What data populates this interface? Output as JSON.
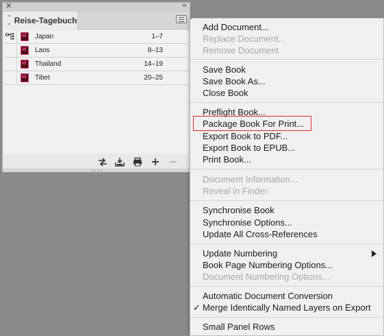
{
  "panel": {
    "tab_title": "Reise-Tagebuch",
    "documents": [
      {
        "name": "Japan",
        "pages": "1–7"
      },
      {
        "name": "Laos",
        "pages": "8–13"
      },
      {
        "name": "Thailand",
        "pages": "14–19"
      },
      {
        "name": "Tibet",
        "pages": "20–25"
      }
    ],
    "footer_icons": [
      "synchronize-icon",
      "save-book-icon",
      "print-icon",
      "add-document-icon",
      "remove-document-icon"
    ]
  },
  "menu": {
    "add_document": "Add Document...",
    "replace_document": "Replace Document...",
    "remove_document": "Remove Document",
    "save_book": "Save Book",
    "save_book_as": "Save Book As...",
    "close_book": "Close Book",
    "preflight_book": "Preflight Book...",
    "package_book": "Package Book For Print...",
    "export_pdf": "Export Book to PDF...",
    "export_epub": "Export Book to EPUB...",
    "print_book": "Print Book...",
    "document_information": "Document Information...",
    "reveal_in_finder": "Reveal in Finder",
    "synchronise_book": "Synchronise Book",
    "synchronise_options": "Synchronise Options...",
    "update_cross_refs": "Update All Cross-References",
    "update_numbering": "Update Numbering",
    "book_page_numbering": "Book Page Numbering Options...",
    "document_numbering": "Document Numbering Options...",
    "automatic_conversion": "Automatic Document Conversion",
    "merge_layers": "Merge Identically Named Layers on Export",
    "merge_layers_check": "✓",
    "small_panel_rows": "Small Panel Rows"
  },
  "colors": {
    "highlight": "#e0262b",
    "background": "#8a8a8a"
  }
}
